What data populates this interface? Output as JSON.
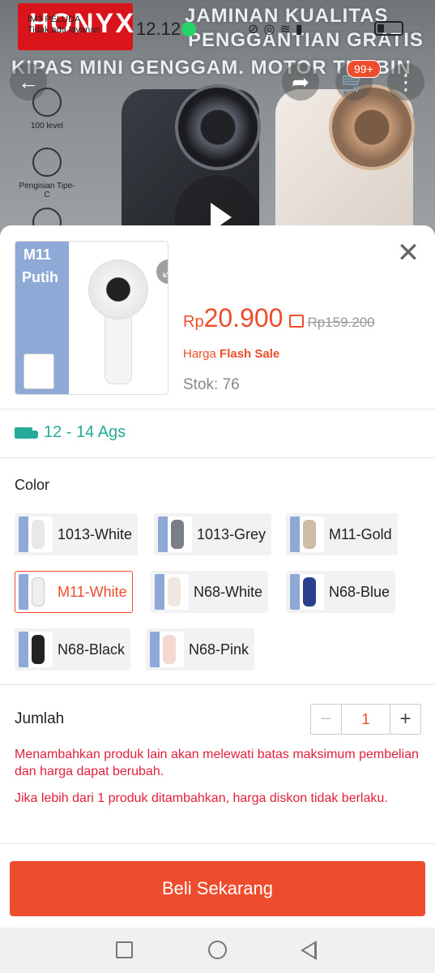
{
  "status_bar": {
    "carrier_line1": "IM3 PELUDA",
    "carrier_line2": "Tidak ada layanan",
    "time": "12.12"
  },
  "banner": {
    "brand": "HONYX",
    "headline1": "JAMINAN KUALITAS",
    "headline2": "PENGGANTIAN GRATIS",
    "headline3": "KIPAS MINI GENGGAM. MOTOR TURBIN",
    "features": [
      "100 level",
      "Pengisian Tipe-C"
    ],
    "cart_badge": "99+"
  },
  "sheet": {
    "thumb_model": "M11",
    "thumb_color": "Putih",
    "currency": "Rp",
    "price": "20.900",
    "original_price": "Rp159.200",
    "flash_prefix": "Harga",
    "flash_label": "Flash Sale",
    "stock": "Stok: 76",
    "shipping": "12 - 14 Ags",
    "color_heading": "Color",
    "variants": [
      "1013-White",
      "1013-Grey",
      "M11-Gold",
      "M11-White",
      "N68-White",
      "N68-Blue",
      "N68-Black",
      "N68-Pink"
    ],
    "selected_variant": "M11-White",
    "qty_label": "Jumlah",
    "qty_minus": "−",
    "qty_value": "1",
    "qty_plus": "+",
    "warning1": "Menambahkan produk lain akan melewati batas maksimum pembelian dan harga dapat berubah.",
    "warning2": "Jika lebih dari 1 produk ditambahkan, harga diskon tidak berlaku.",
    "buy_label": "Beli Sekarang"
  },
  "colors": {
    "accent": "#ee4d2d",
    "shipping": "#26aa99",
    "warning": "#e0213d"
  }
}
